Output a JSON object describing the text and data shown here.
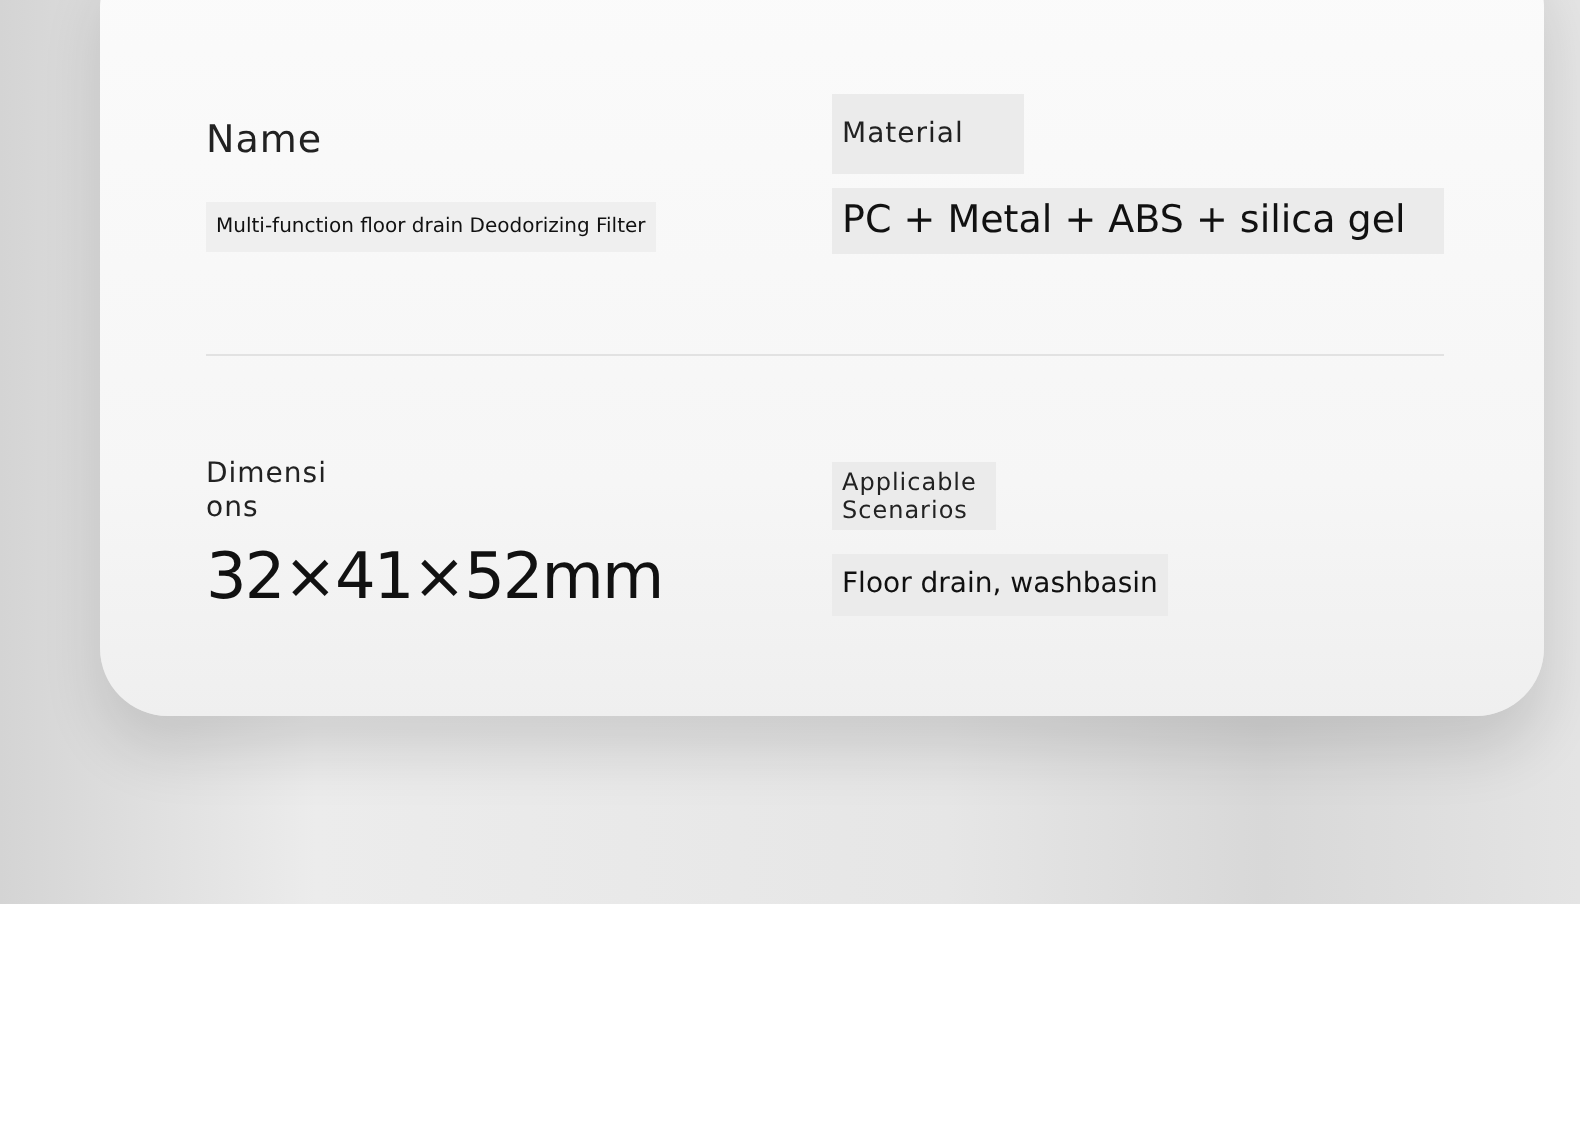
{
  "specs": [
    {
      "label": "Name",
      "value": "Multi-function floor drain Deodorizing Filter",
      "kind": "small"
    },
    {
      "label": "Material",
      "value": "PC + Metal + ABS + silica gel",
      "kind": "medium"
    },
    {
      "label": "Dimensions",
      "value": "32×41×52mm",
      "kind": "large"
    },
    {
      "label": "Applicable Scenarios",
      "value": "Floor drain, washbasin",
      "kind": "plain"
    }
  ]
}
